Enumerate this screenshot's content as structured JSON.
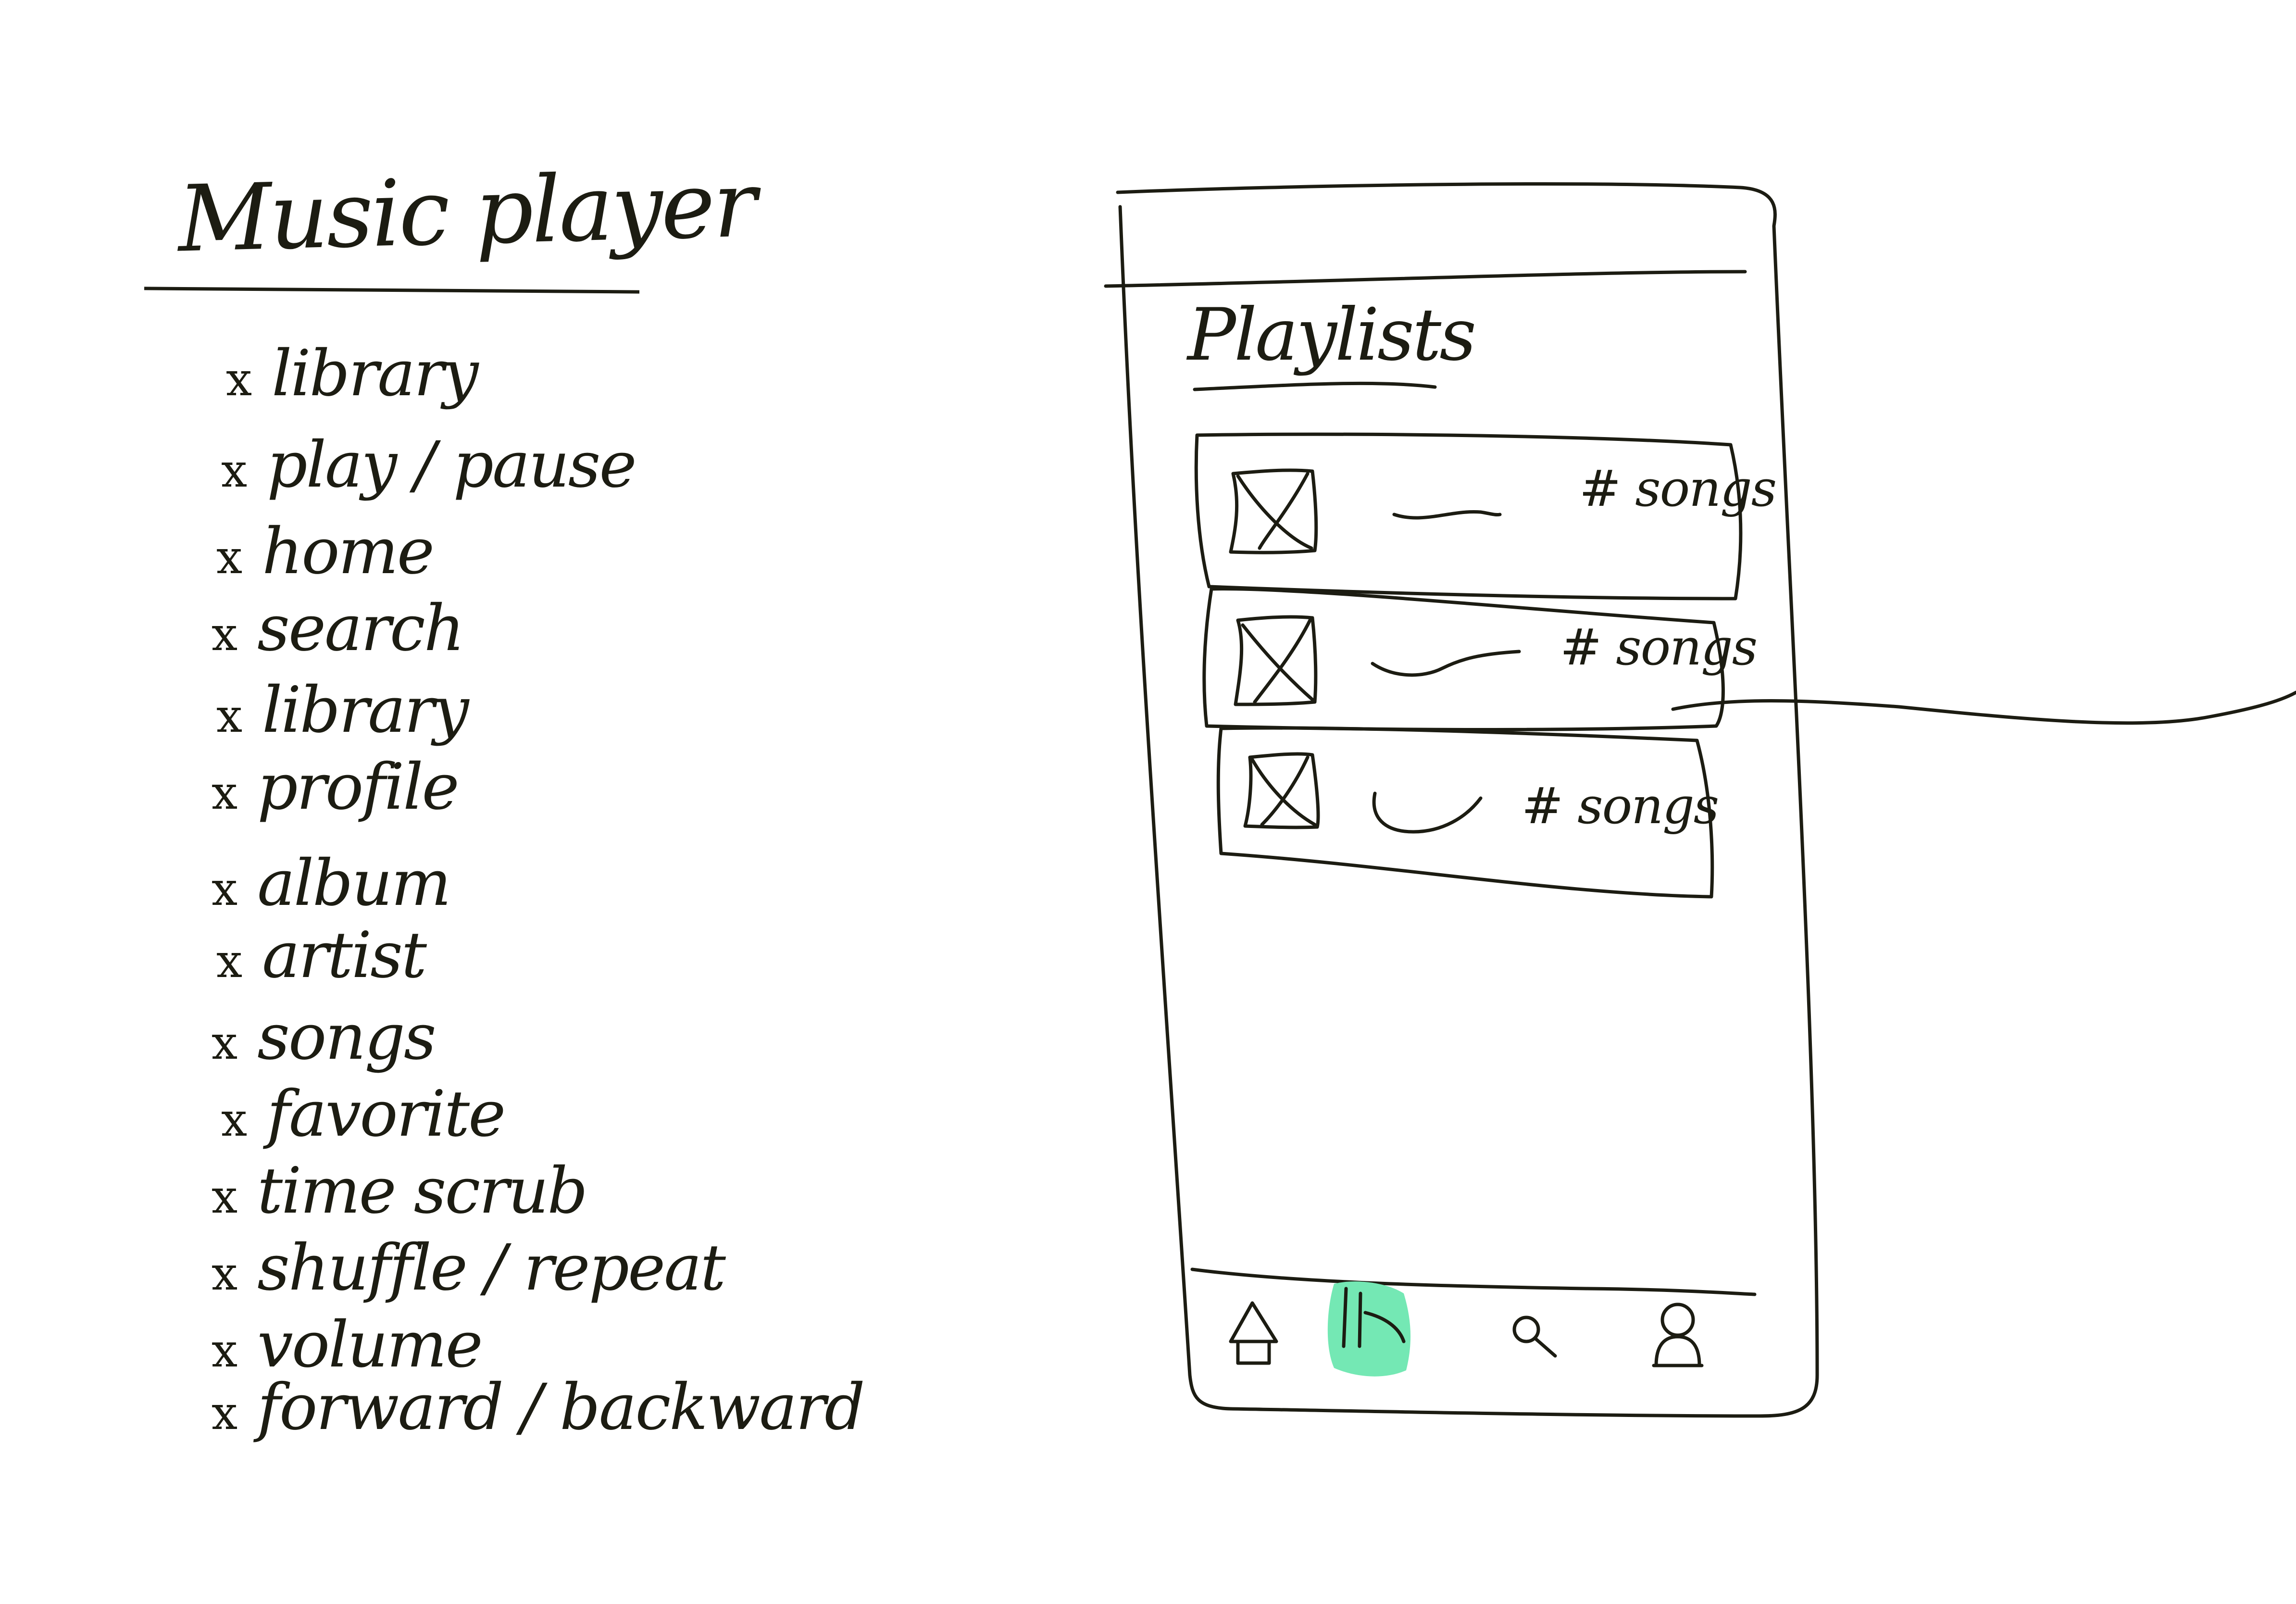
{
  "sketch": {
    "title": "Music player",
    "features": [
      "library",
      "play / pause",
      "home",
      "search",
      "library",
      "profile",
      "album",
      "artist",
      "songs",
      "favorite",
      "time scrub",
      "shuffle / repeat",
      "volume",
      "forward / backward"
    ],
    "bullet": "x"
  },
  "phone": {
    "screen_title": "Playlists",
    "playlists": [
      {
        "count_label": "# songs",
        "cover_icon": "image-placeholder-icon"
      },
      {
        "count_label": "# songs",
        "cover_icon": "image-placeholder-icon"
      },
      {
        "count_label": "# songs",
        "cover_icon": "image-placeholder-icon"
      }
    ],
    "tab_bar": [
      {
        "name": "home",
        "icon": "home-icon"
      },
      {
        "name": "library",
        "icon": "library-icon",
        "active": true
      },
      {
        "name": "search",
        "icon": "search-icon"
      },
      {
        "name": "profile",
        "icon": "profile-icon"
      }
    ]
  },
  "colors": {
    "ink": "#1c1c12",
    "background": "#ffffff",
    "active_highlight": "#74e8b4"
  }
}
